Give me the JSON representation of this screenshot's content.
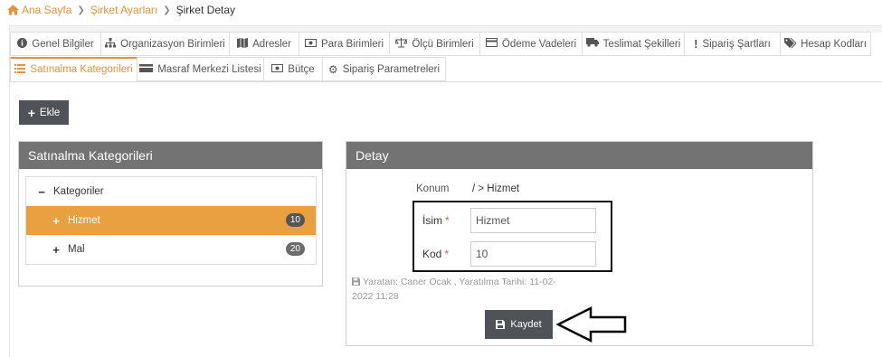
{
  "breadcrumb": {
    "home": "Ana Sayfa",
    "settings": "Şirket Ayarları",
    "current": "Şirket Detay"
  },
  "tabs_row1": [
    {
      "label": "Genel Bilgiler",
      "icon": "info-circle-icon"
    },
    {
      "label": "Organizasyon Birimleri",
      "icon": "sitemap-icon"
    },
    {
      "label": "Adresler",
      "icon": "map-icon"
    },
    {
      "label": "Para Birimleri",
      "icon": "money-icon"
    },
    {
      "label": "Ölçü Birimleri",
      "icon": "balance-scale-icon"
    },
    {
      "label": "Ödeme Vadeleri",
      "icon": "credit-card-icon"
    },
    {
      "label": "Teslimat Şekilleri",
      "icon": "truck-icon"
    },
    {
      "label": "Sipariş Şartları",
      "icon": "exclamation-icon"
    },
    {
      "label": "Hesap Kodları",
      "icon": "tags-icon"
    }
  ],
  "tabs_row2": [
    {
      "label": "Satınalma Kategorileri",
      "icon": "list-icon",
      "active": true
    },
    {
      "label": "Masraf Merkezi Listesi",
      "icon": "card-icon"
    },
    {
      "label": "Bütçe",
      "icon": "money-icon"
    },
    {
      "label": "Sipariş Parametreleri",
      "icon": "gear-icon"
    }
  ],
  "toolbar": {
    "add_label": "Ekle"
  },
  "left_panel": {
    "title": "Satınalma Kategorileri",
    "root": "Kategoriler",
    "items": [
      {
        "label": "Hizmet",
        "count": "10",
        "selected": true
      },
      {
        "label": "Mal",
        "count": "20",
        "selected": false
      }
    ]
  },
  "right_panel": {
    "title": "Detay",
    "konum_label": "Konum",
    "konum_value": "/ > Hizmet",
    "name_label": "İsim",
    "name_value": "Hizmet",
    "code_label": "Kod",
    "code_value": "10",
    "required_mark": "*",
    "meta_text": "Yaratan: Caner Ocak , Yaratılma Tarihi: 11-02-2022 11:28",
    "save_label": "Kaydet"
  },
  "colors": {
    "accent": "#e8913a",
    "panel_header": "#737373",
    "button": "#4f5256",
    "selected_row": "#e8a040"
  }
}
